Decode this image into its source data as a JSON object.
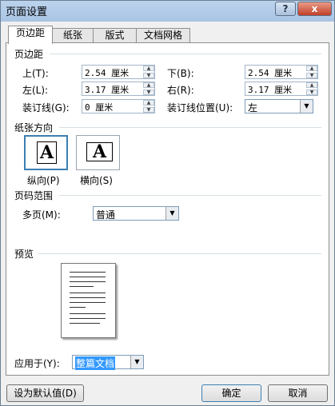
{
  "title": "页面设置",
  "tabs": [
    "页边距",
    "纸张",
    "版式",
    "文档网格"
  ],
  "margins": {
    "section_title": "页边距",
    "top_label": "上(T):",
    "top_value": "2.54 厘米",
    "bottom_label": "下(B):",
    "bottom_value": "2.54 厘米",
    "left_label": "左(L):",
    "left_value": "3.17 厘米",
    "right_label": "右(R):",
    "right_value": "3.17 厘米",
    "gutter_label": "装订线(G):",
    "gutter_value": "0 厘米",
    "gutter_pos_label": "装订线位置(U):",
    "gutter_pos_value": "左"
  },
  "orientation": {
    "section_title": "纸张方向",
    "portrait_label": "纵向(P)",
    "landscape_label": "横向(S)",
    "glyph": "A",
    "selected": "portrait"
  },
  "pages": {
    "section_title": "页码范围",
    "multi_label": "多页(M):",
    "multi_value": "普通"
  },
  "preview": {
    "section_title": "预览"
  },
  "apply": {
    "label": "应用于(Y):",
    "value": "整篇文档"
  },
  "buttons": {
    "default": "设为默认值(D)",
    "ok": "确定",
    "cancel": "取消"
  },
  "titlebar": {
    "help": "?",
    "close": "x"
  },
  "icons": {
    "spinner_up": "▲",
    "spinner_down": "▼",
    "dropdown": "▼"
  }
}
